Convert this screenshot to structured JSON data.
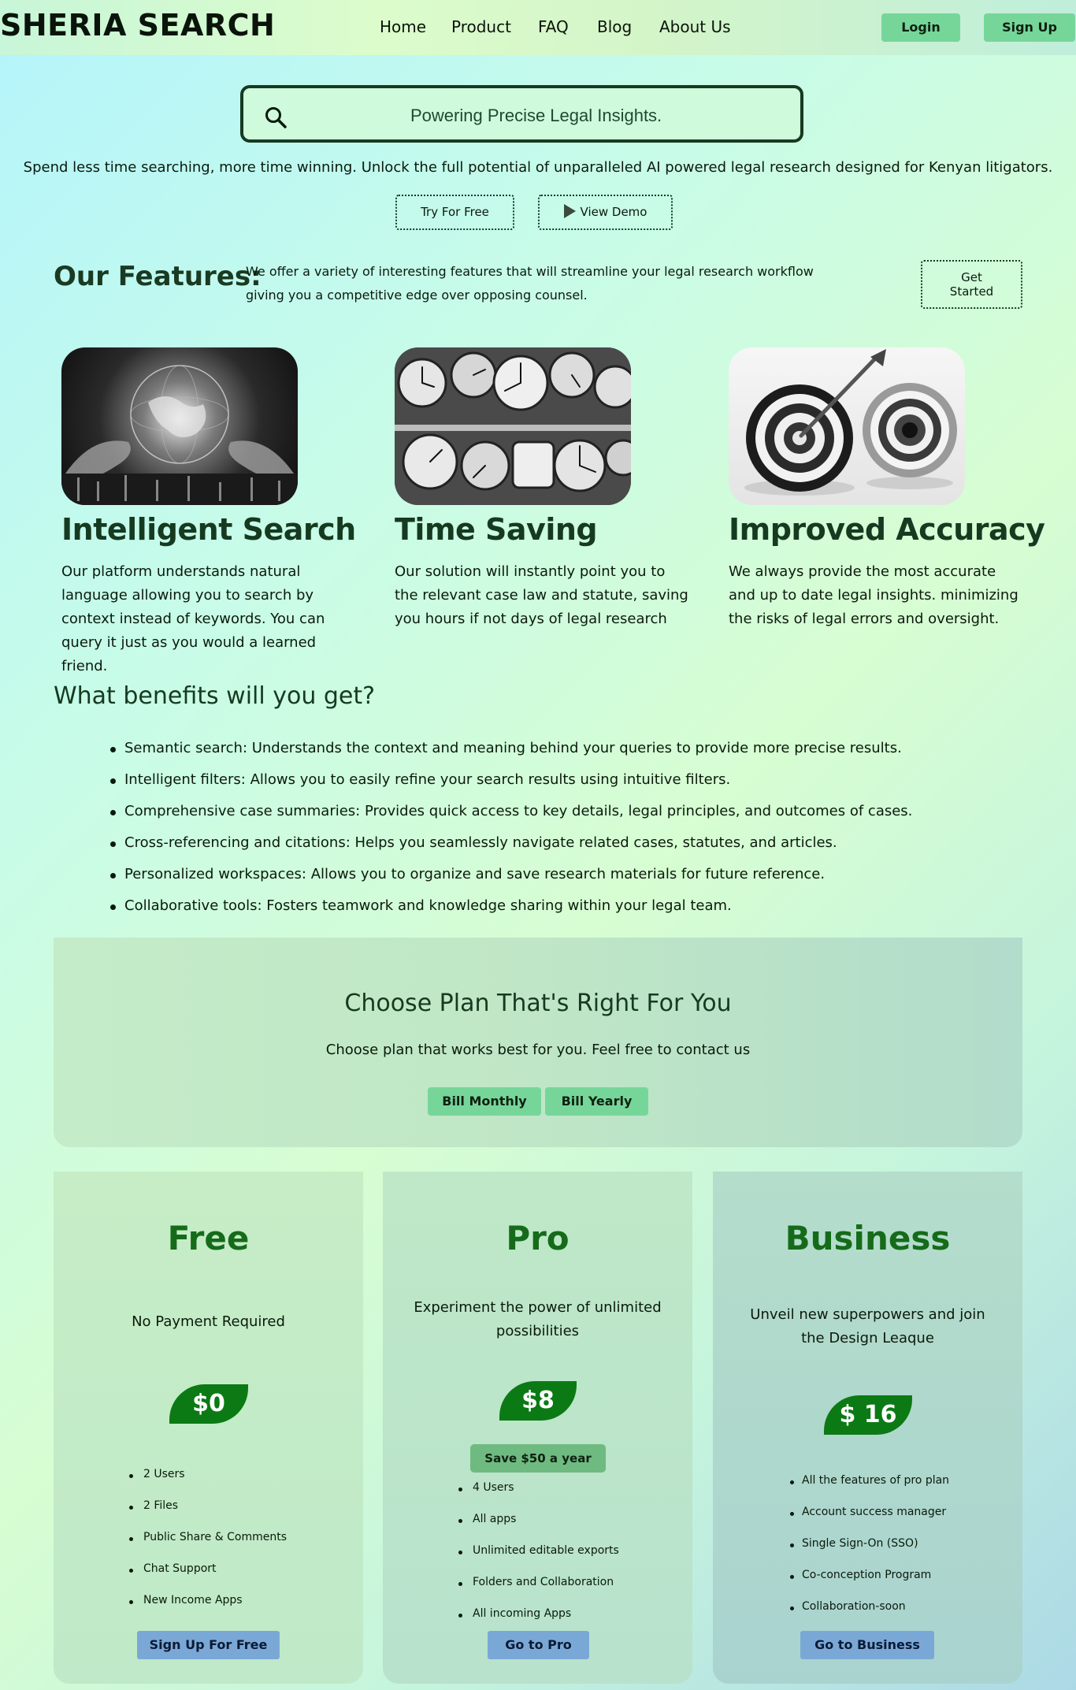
{
  "brand": "SHERIA SEARCH",
  "nav": {
    "links": [
      "Home",
      "Product",
      "FAQ",
      "Blog",
      "About Us"
    ],
    "login": "Login",
    "signup": "Sign Up"
  },
  "search": {
    "placeholder": "Powering Precise Legal Insights.",
    "icon": "search-icon"
  },
  "hero": {
    "tagline": "Spend less time searching, more time winning. Unlock the full potential of unparalleled AI powered legal research designed for Kenyan litigators.",
    "try_free": "Try For Free",
    "view_demo": "View Demo"
  },
  "features": {
    "heading": "Our Features:",
    "description": "We offer a variety of interesting features that will streamline your legal research workflow giving you a competitive edge over opposing counsel.",
    "get_started": "Get Started",
    "items": [
      {
        "title": "Intelligent Search",
        "text": "Our platform understands natural language allowing you to search by context instead of keywords. You can query it just as you would a learned friend.",
        "image": "globe-hands-image"
      },
      {
        "title": "Time Saving",
        "text": "Our solution will instantly point you to the relevant case law and statute, saving you hours if not days of legal research",
        "image": "alarm-clocks-image"
      },
      {
        "title": "Improved Accuracy",
        "text": "We always provide the most accurate and up to date legal insights. minimizing the risks of legal errors and oversight.",
        "image": "dartboard-targets-image"
      }
    ]
  },
  "benefits": {
    "title": "What benefits will you get?",
    "items": [
      "Semantic search: Understands the context and meaning behind your queries to provide more precise results.",
      "Intelligent filters: Allows you to easily refine your search results using intuitive filters.",
      "Comprehensive case summaries: Provides quick access to key details, legal principles, and outcomes of cases.",
      "Cross-referencing and citations: Helps you seamlessly navigate related cases, statutes, and articles.",
      "Personalized workspaces: Allows you to organize and save research materials for future reference.",
      "Collaborative tools: Fosters teamwork and knowledge sharing within your legal team."
    ]
  },
  "plans": {
    "title": "Choose Plan That's Right For You",
    "subtitle": "Choose plan that works best for you. Feel free to contact us",
    "bill_monthly": "Bill Monthly",
    "bill_yearly": "Bill Yearly",
    "cards": [
      {
        "name": "Free",
        "subtitle": "No Payment Required",
        "price": "$0",
        "features": [
          "2 Users",
          "2 Files",
          "Public Share & Comments",
          "Chat Support",
          "New Income Apps"
        ],
        "cta": "Sign Up For Free"
      },
      {
        "name": "Pro",
        "subtitle": "Experiment the power of unlimited possibilities",
        "price": "$8",
        "save": "Save $50 a year",
        "features": [
          "4 Users",
          "All apps",
          "Unlimited editable exports",
          "Folders and Collaboration",
          "All incoming Apps"
        ],
        "cta": "Go to Pro"
      },
      {
        "name": "Business",
        "subtitle": "Unveil new superpowers and join the Design Leaque",
        "price": "$ 16",
        "features": [
          "All the features of pro plan",
          "Account success manager",
          "Single Sign-On (SSO)",
          "Co-conception Program",
          "Collaboration-soon"
        ],
        "cta": "Go to Business"
      }
    ]
  },
  "colors": {
    "accent_green": "#76d69a",
    "price_green": "#0b7a14",
    "heading_green": "#163a20",
    "cta_blue": "#7aa8d6"
  }
}
